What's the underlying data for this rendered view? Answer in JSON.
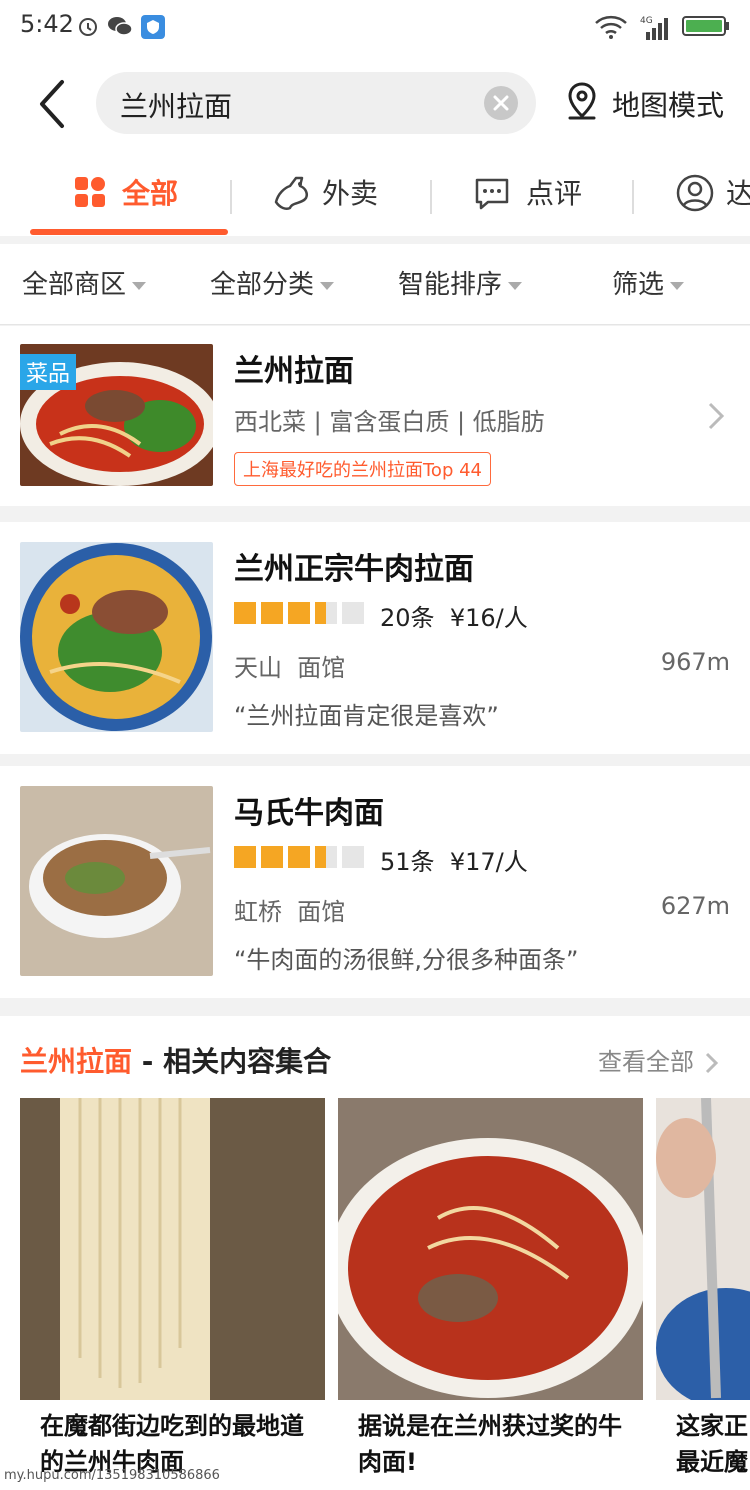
{
  "status_bar": {
    "time": "5:42",
    "network": "4G"
  },
  "header": {
    "search_value": "兰州拉面",
    "map_mode_label": "地图模式"
  },
  "tabs": [
    {
      "label": "全部",
      "active": true
    },
    {
      "label": "外卖",
      "active": false
    },
    {
      "label": "点评",
      "active": false
    },
    {
      "label": "达",
      "active": false
    }
  ],
  "filters": [
    "全部商区",
    "全部分类",
    "智能排序",
    "筛选"
  ],
  "results": [
    {
      "type": "dish",
      "badge": "菜品",
      "title": "兰州拉面",
      "subtitle": "西北菜 | 富含蛋白质 | 低脂肪",
      "tag": "上海最好吃的兰州拉面Top 44"
    },
    {
      "type": "shop",
      "title": "兰州正宗牛肉拉面",
      "rating": 3.5,
      "reviews": "20条",
      "price": "¥16/人",
      "location": "天山",
      "category": "面馆",
      "distance": "967m",
      "quote": "“兰州拉面肯定很是喜欢”"
    },
    {
      "type": "shop",
      "title": "马氏牛肉面",
      "rating": 3.5,
      "reviews": "51条",
      "price": "¥17/人",
      "location": "虹桥",
      "category": "面馆",
      "distance": "627m",
      "quote": "“牛肉面的汤很鲜,分很多种面条”"
    }
  ],
  "related": {
    "keyword": "兰州拉面",
    "title_suffix": " - 相关内容集合",
    "more_label": "查看全部",
    "items": [
      {
        "text": "在魔都街边吃到的最地道的兰州牛肉面"
      },
      {
        "text": "据说是在兰州获过奖的牛肉面!"
      },
      {
        "text": "这家正最近魔"
      }
    ]
  },
  "watermark": "my.hupu.com/135198310586866",
  "colors": {
    "accent": "#ff5b2e",
    "star": "#f5a623",
    "badge": "#2aa6e8"
  }
}
